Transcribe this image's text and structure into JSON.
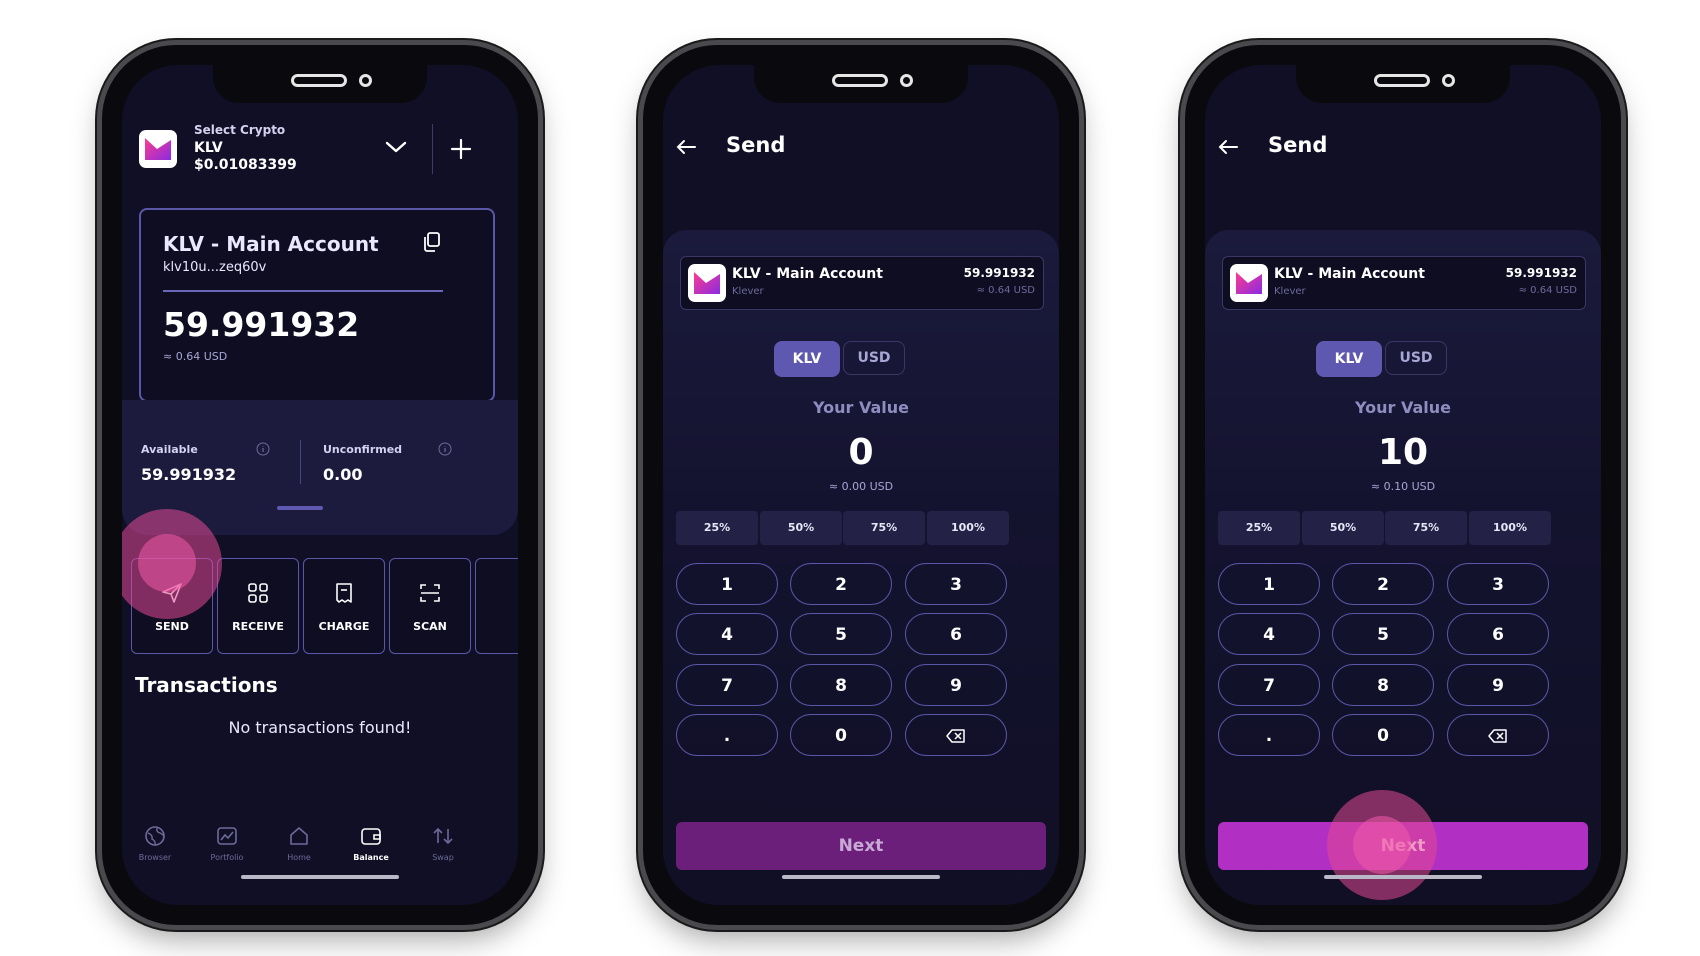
{
  "colors": {
    "background": "#100f25",
    "accent": "#5e58b0",
    "next_disabled": "#6b1f7a",
    "next_active": "#b22fc4",
    "tap": "#e24896"
  },
  "screen1": {
    "select_label": "Select Crypto",
    "ticker": "KLV",
    "price": "$0.01083399",
    "account_title": "KLV - Main Account",
    "address": "klv10u...zeq60v",
    "balance": "59.991932",
    "balance_usd": "≈ 0.64 USD",
    "available_label": "Available",
    "available_value": "59.991932",
    "unconfirmed_label": "Unconfirmed",
    "unconfirmed_value": "0.00",
    "actions": [
      "SEND",
      "RECEIVE",
      "CHARGE",
      "SCAN"
    ],
    "transactions_title": "Transactions",
    "empty_text": "No transactions found!",
    "nav": [
      "Browser",
      "Portfolio",
      "Home",
      "Balance",
      "Swap"
    ],
    "nav_active": "Balance"
  },
  "send": {
    "title": "Send",
    "account_name": "KLV - Main Account",
    "account_sub": "Klever",
    "account_balance": "59.991932",
    "account_usd": "≈ 0.64 USD",
    "currency_options": [
      "KLV",
      "USD"
    ],
    "currency_selected": "KLV",
    "value_label": "Your Value",
    "percent_options": [
      "25%",
      "50%",
      "75%",
      "100%"
    ],
    "keys": [
      "1",
      "2",
      "3",
      "4",
      "5",
      "6",
      "7",
      "8",
      "9",
      ".",
      "0"
    ],
    "next_label": "Next"
  },
  "screen2": {
    "amount": "0",
    "amount_usd": "≈ 0.00 USD"
  },
  "screen3": {
    "amount": "10",
    "amount_usd": "≈ 0.10 USD"
  }
}
